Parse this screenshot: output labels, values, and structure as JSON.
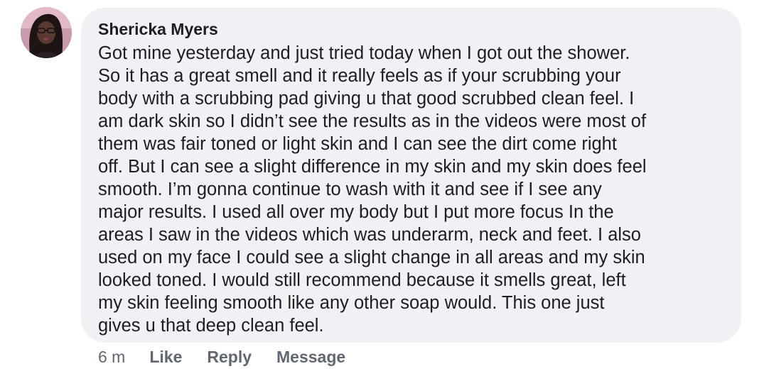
{
  "comment": {
    "author": "Shericka Myers",
    "lines": [
      "Got mine yesterday and just tried today when I got out the shower.",
      "So it has a great smell and it really feels as if your scrubbing your",
      "body with a scrubbing pad giving u that good scrubbed clean feel. I",
      "am dark skin so I didn’t see the results as in the videos were most of",
      "them was fair toned or light skin and I can see the dirt come right",
      "off. But I can see a slight difference in my skin and my skin does feel",
      "smooth. I’m gonna continue to wash with it and see if I see any",
      "major results. I used all over my body but I put more focus In the",
      "areas I saw in the videos which was underarm, neck and feet. I also",
      "used on my face I could see a slight change in all areas and my skin",
      "looked toned. I would still recommend because it smells great, left",
      "my skin feeling smooth like any other soap would. This one just",
      "gives u that deep clean feel."
    ],
    "timestamp": "6 m",
    "actions": {
      "like": "Like",
      "reply": "Reply",
      "message": "Message"
    }
  },
  "colors": {
    "bubble_background": "#f0f1f4",
    "text": "#1c1e21",
    "meta_text": "#606770"
  }
}
